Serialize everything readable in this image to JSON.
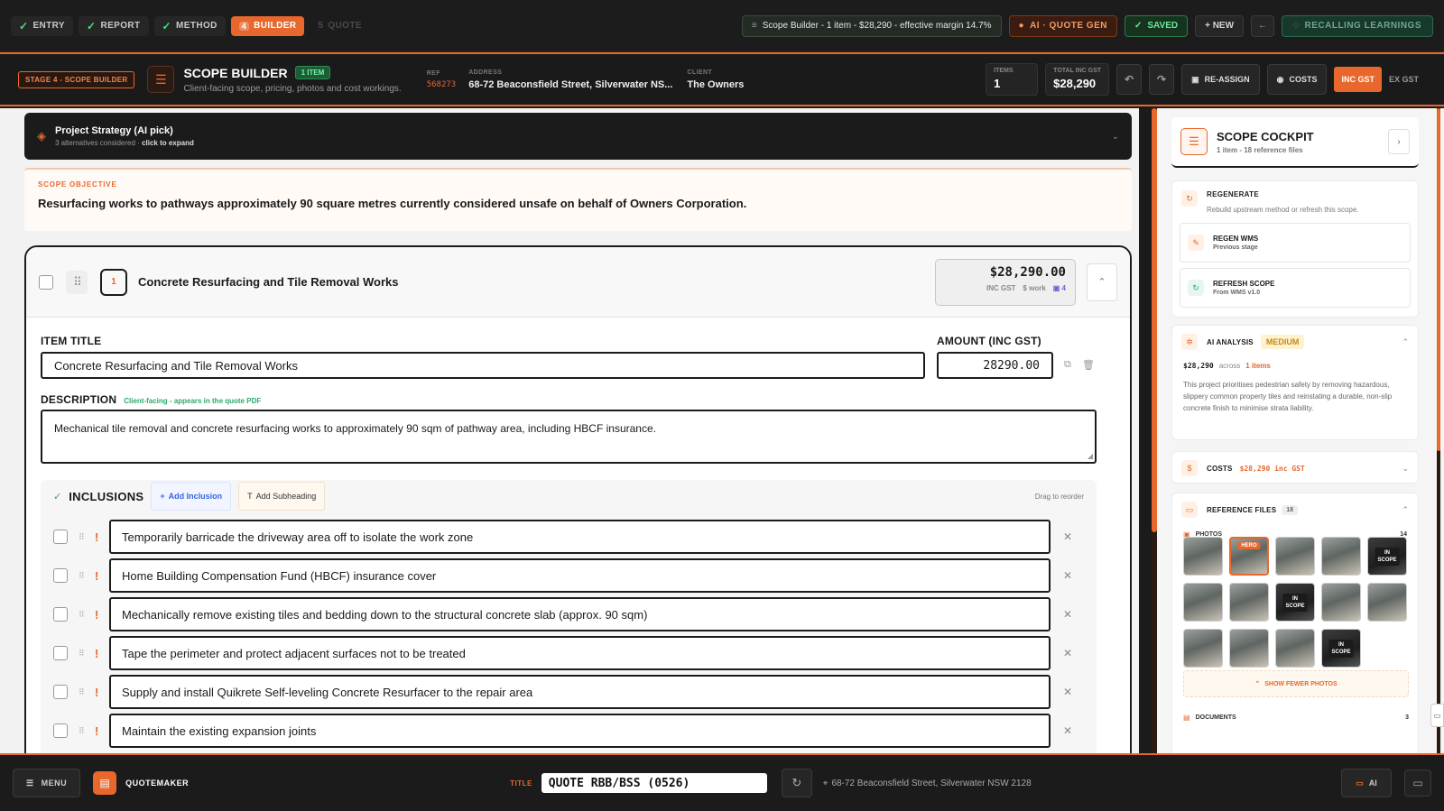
{
  "steps": [
    {
      "label": "ENTRY",
      "state": "done"
    },
    {
      "label": "REPORT",
      "state": "done"
    },
    {
      "label": "METHOD",
      "state": "done"
    },
    {
      "label": "BUILDER",
      "num": "4",
      "state": "active"
    },
    {
      "label": "QUOTE",
      "num": "5",
      "state": "future"
    }
  ],
  "topbar": {
    "status": "Scope Builder - 1 item - $28,290 - effective margin 14.7%",
    "ai": "AI · QUOTE GEN",
    "saved": "SAVED",
    "new": "+ NEW",
    "back": "←",
    "recall": "RECALLING LEARNINGS"
  },
  "header": {
    "stage": "STAGE 4 - SCOPE BUILDER",
    "title": "SCOPE BUILDER",
    "badge": "1 ITEM",
    "subtitle": "Client-facing scope, pricing, photos and cost workings.",
    "ref_label": "REF",
    "ref": "568273",
    "address_label": "ADDRESS",
    "address": "68-72 Beaconsfield Street, Silverwater NS...",
    "client_label": "CLIENT",
    "client": "The Owners",
    "items_label": "ITEMS",
    "items": "1",
    "total_label": "TOTAL INC GST",
    "total": "$28,290",
    "reassign": "RE-ASSIGN",
    "costs": "COSTS",
    "inc_gst": "INC GST",
    "ex_gst": "EX GST"
  },
  "strategy": {
    "title": "Project Strategy (AI pick)",
    "sub": "3 alternatives considered ·",
    "sub_action": "click to expand"
  },
  "objective": {
    "label": "SCOPE OBJECTIVE",
    "text": "Resurfacing works to pathways approximately 90 square metres currently considered unsafe on behalf of Owners Corporation."
  },
  "item": {
    "number": "1",
    "name": "Concrete Resurfacing and Tile Removal Works",
    "price": "$28,290.00",
    "price_tag": "INC GST",
    "work_tag": "work",
    "photo_count": "4",
    "title_label": "ITEM TITLE",
    "title_value": "Concrete Resurfacing and Tile Removal Works",
    "amount_label": "AMOUNT (INC GST)",
    "amount_value": "28290.00",
    "description_label": "DESCRIPTION",
    "description_hint": "Client-facing - appears in the quote PDF",
    "description": "Mechanical tile removal and concrete resurfacing works to approximately 90 sqm of pathway area, including HBCF insurance."
  },
  "inclusions": {
    "title": "INCLUSIONS",
    "add_inclusion": "Add Inclusion",
    "add_subheading": "Add Subheading",
    "drag_hint": "Drag to reorder",
    "items": [
      "Temporarily barricade the driveway area off to isolate the work zone",
      "Home Building Compensation Fund (HBCF) insurance cover",
      "Mechanically remove existing tiles and bedding down to the structural concrete slab (approx. 90 sqm)",
      "Tape the perimeter and protect adjacent surfaces not to be treated",
      "Supply and install Quikrete Self-leveling Concrete Resurfacer to the repair area",
      "Maintain the existing expansion joints"
    ]
  },
  "cockpit": {
    "title": "SCOPE COCKPIT",
    "sub": "1 item - 18 reference files",
    "regen_title": "REGENERATE",
    "regen_sub": "Rebuild upstream method or refresh this scope.",
    "regen_wms": "REGEN WMS",
    "regen_wms_sub": "Previous stage",
    "refresh_scope": "REFRESH SCOPE",
    "refresh_scope_sub": "From WMS v1.0",
    "ai_title": "AI ANALYSIS",
    "ai_level": "MEDIUM",
    "ai_amount": "$28,290",
    "ai_across": "across",
    "ai_items": "1 items",
    "ai_text": "This project prioritises pedestrian safety by removing hazardous, slippery common property tiles and reinstating a durable, non-slip concrete finish to minimise strata liability.",
    "costs_title": "COSTS",
    "costs_amount": "$28,290 inc GST",
    "ref_title": "REFERENCE FILES",
    "ref_count": "18",
    "photos_label": "PHOTOS",
    "photos_count": "14",
    "hero": "HERO",
    "in_scope": "IN SCOPE",
    "show_fewer": "SHOW FEWER PHOTOS",
    "docs_label": "DOCUMENTS",
    "docs_count": "3"
  },
  "bottombar": {
    "menu": "MENU",
    "app": "QUOTEMAKER",
    "title_label": "TITLE",
    "title_value": "QUOTE RBB/BSS (0526)",
    "address": "68-72 Beaconsfield Street, Silverwater NSW 2128",
    "ai": "AI"
  },
  "colors": {
    "accent": "#e8672c",
    "success": "#2ea86a",
    "dark": "#1b1b1b"
  }
}
